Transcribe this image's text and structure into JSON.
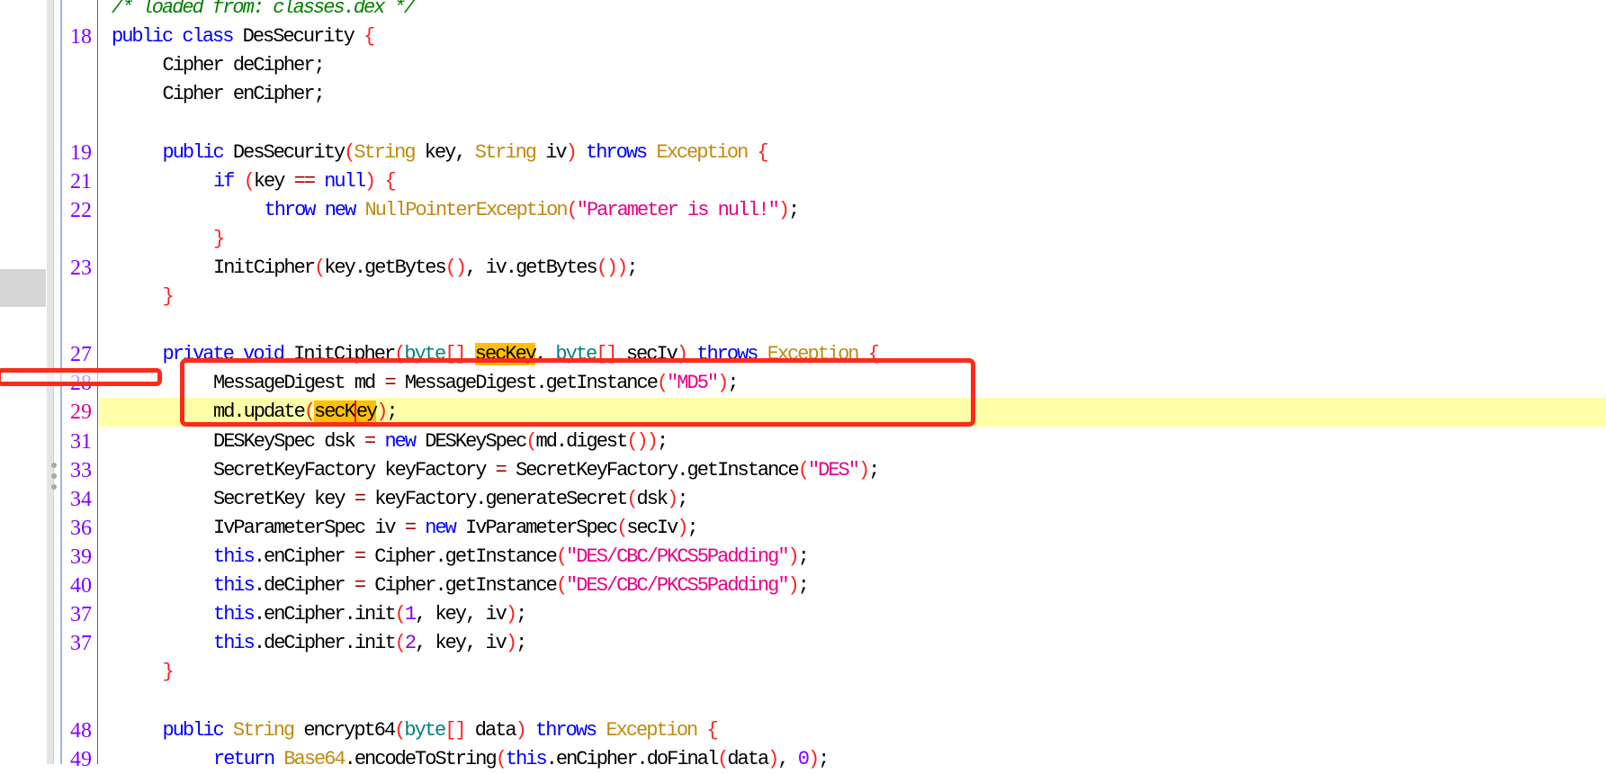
{
  "editor": {
    "colors": {
      "keyword": "#0000ff",
      "type": "#c08a10",
      "paren": "#ff2020",
      "string": "#e6008a",
      "comment": "#008000",
      "line_number": "#8000ff",
      "current_line": "#ffffa8",
      "highlight": "#ffc000",
      "annotation": "#ff2a1a"
    },
    "current_line_number": "29",
    "lines": [
      {
        "n": "",
        "i": 0,
        "t": [
          [
            "/* loaded from: classes.dex */",
            "c"
          ]
        ]
      },
      {
        "n": "18",
        "i": 0,
        "t": [
          [
            "public class",
            "k"
          ],
          [
            " DesSecurity ",
            "v"
          ],
          [
            "{",
            "p"
          ]
        ]
      },
      {
        "n": "",
        "i": 1,
        "t": [
          [
            "Cipher deCipher;",
            "v"
          ]
        ]
      },
      {
        "n": "",
        "i": 1,
        "t": [
          [
            "Cipher enCipher;",
            "v"
          ]
        ]
      },
      {
        "n": "",
        "i": 0,
        "t": []
      },
      {
        "n": "19",
        "i": 1,
        "t": [
          [
            "public",
            "k"
          ],
          [
            " DesSecurity",
            "v"
          ],
          [
            "(",
            "p"
          ],
          [
            "String",
            "ty"
          ],
          [
            " key, ",
            "v"
          ],
          [
            "String",
            "ty"
          ],
          [
            " iv",
            "v"
          ],
          [
            ")",
            "p"
          ],
          [
            " throws ",
            "k"
          ],
          [
            "Exception ",
            "ty"
          ],
          [
            "{",
            "p"
          ]
        ]
      },
      {
        "n": "21",
        "i": 2,
        "t": [
          [
            "if ",
            "k"
          ],
          [
            "(",
            "p"
          ],
          [
            "key ",
            "v"
          ],
          [
            "==",
            "op"
          ],
          [
            " null",
            "k"
          ],
          [
            ")",
            "p"
          ],
          [
            " {",
            "p"
          ]
        ]
      },
      {
        "n": "22",
        "i": 3,
        "t": [
          [
            "throw new ",
            "k"
          ],
          [
            "NullPointerException",
            "ty"
          ],
          [
            "(",
            "p"
          ],
          [
            "\"Parameter is null!\"",
            "s"
          ],
          [
            ")",
            "p"
          ],
          [
            ";",
            "v"
          ]
        ]
      },
      {
        "n": "",
        "i": 2,
        "t": [
          [
            "}",
            "p"
          ]
        ]
      },
      {
        "n": "23",
        "i": 2,
        "t": [
          [
            "InitCipher",
            "v"
          ],
          [
            "(",
            "p"
          ],
          [
            "key.getBytes",
            "v"
          ],
          [
            "()",
            "p"
          ],
          [
            ", iv.getBytes",
            "v"
          ],
          [
            "())",
            "p"
          ],
          [
            ";",
            "v"
          ]
        ]
      },
      {
        "n": "",
        "i": 1,
        "t": [
          [
            "}",
            "p"
          ]
        ]
      },
      {
        "n": "",
        "i": 0,
        "t": []
      },
      {
        "n": "27",
        "i": 1,
        "t": [
          [
            "private void",
            "k"
          ],
          [
            " InitCipher",
            "v"
          ],
          [
            "(",
            "p"
          ],
          [
            "byte",
            "te"
          ],
          [
            "[]",
            "p"
          ],
          [
            " ",
            "v"
          ],
          [
            "secKey",
            "v hl"
          ],
          [
            ", ",
            "v"
          ],
          [
            "byte",
            "te"
          ],
          [
            "[]",
            "p"
          ],
          [
            " secIv",
            "v"
          ],
          [
            ")",
            "p"
          ],
          [
            " throws ",
            "k"
          ],
          [
            "Exception ",
            "ty"
          ],
          [
            "{",
            "p"
          ]
        ]
      },
      {
        "n": "28",
        "i": 2,
        "t": [
          [
            "MessageDigest md ",
            "v"
          ],
          [
            "=",
            "op"
          ],
          [
            " MessageDigest.getInstance",
            "v"
          ],
          [
            "(",
            "p"
          ],
          [
            "\"MD5\"",
            "s"
          ],
          [
            ")",
            "p"
          ],
          [
            ";",
            "v"
          ]
        ]
      },
      {
        "n": "29",
        "i": 2,
        "t": [
          [
            "md.update",
            "v"
          ],
          [
            "(",
            "p"
          ],
          [
            "secK",
            "v hl"
          ],
          [
            "ey",
            "v hl cur"
          ],
          [
            ")",
            "p"
          ],
          [
            ";",
            "v"
          ]
        ]
      },
      {
        "n": "31",
        "i": 2,
        "t": [
          [
            "DESKeySpec dsk ",
            "v"
          ],
          [
            "=",
            "op"
          ],
          [
            " new ",
            "k"
          ],
          [
            "DESKeySpec",
            "v"
          ],
          [
            "(",
            "p"
          ],
          [
            "md.digest",
            "v"
          ],
          [
            "())",
            "p"
          ],
          [
            ";",
            "v"
          ]
        ]
      },
      {
        "n": "33",
        "i": 2,
        "t": [
          [
            "SecretKeyFactory keyFactory ",
            "v"
          ],
          [
            "=",
            "op"
          ],
          [
            " SecretKeyFactory.getInstance",
            "v"
          ],
          [
            "(",
            "p"
          ],
          [
            "\"DES\"",
            "s"
          ],
          [
            ")",
            "p"
          ],
          [
            ";",
            "v"
          ]
        ]
      },
      {
        "n": "34",
        "i": 2,
        "t": [
          [
            "SecretKey key ",
            "v"
          ],
          [
            "=",
            "op"
          ],
          [
            " keyFactory.generateSecret",
            "v"
          ],
          [
            "(",
            "p"
          ],
          [
            "dsk",
            "v"
          ],
          [
            ")",
            "p"
          ],
          [
            ";",
            "v"
          ]
        ]
      },
      {
        "n": "36",
        "i": 2,
        "t": [
          [
            "IvParameterSpec iv ",
            "v"
          ],
          [
            "=",
            "op"
          ],
          [
            " new ",
            "k"
          ],
          [
            "IvParameterSpec",
            "v"
          ],
          [
            "(",
            "p"
          ],
          [
            "secIv",
            "v"
          ],
          [
            ")",
            "p"
          ],
          [
            ";",
            "v"
          ]
        ]
      },
      {
        "n": "39",
        "i": 2,
        "t": [
          [
            "this",
            "k"
          ],
          [
            ".enCipher ",
            "v"
          ],
          [
            "=",
            "op"
          ],
          [
            " Cipher.getInstance",
            "v"
          ],
          [
            "(",
            "p"
          ],
          [
            "\"DES/CBC/PKCS5Padding\"",
            "s"
          ],
          [
            ")",
            "p"
          ],
          [
            ";",
            "v"
          ]
        ]
      },
      {
        "n": "40",
        "i": 2,
        "t": [
          [
            "this",
            "k"
          ],
          [
            ".deCipher ",
            "v"
          ],
          [
            "=",
            "op"
          ],
          [
            " Cipher.getInstance",
            "v"
          ],
          [
            "(",
            "p"
          ],
          [
            "\"DES/CBC/PKCS5Padding\"",
            "s"
          ],
          [
            ")",
            "p"
          ],
          [
            ";",
            "v"
          ]
        ]
      },
      {
        "n": "37",
        "i": 2,
        "t": [
          [
            "this",
            "k"
          ],
          [
            ".enCipher.init",
            "v"
          ],
          [
            "(",
            "p"
          ],
          [
            "1",
            "nm"
          ],
          [
            ", key, iv",
            "v"
          ],
          [
            ")",
            "p"
          ],
          [
            ";",
            "v"
          ]
        ]
      },
      {
        "n": "37",
        "i": 2,
        "t": [
          [
            "this",
            "k"
          ],
          [
            ".deCipher.init",
            "v"
          ],
          [
            "(",
            "p"
          ],
          [
            "2",
            "nm"
          ],
          [
            ", key, iv",
            "v"
          ],
          [
            ")",
            "p"
          ],
          [
            ";",
            "v"
          ]
        ]
      },
      {
        "n": "",
        "i": 1,
        "t": [
          [
            "}",
            "p"
          ]
        ]
      },
      {
        "n": "",
        "i": 0,
        "t": []
      },
      {
        "n": "48",
        "i": 1,
        "t": [
          [
            "public ",
            "k"
          ],
          [
            "String",
            "ty"
          ],
          [
            " encrypt64",
            "v"
          ],
          [
            "(",
            "p"
          ],
          [
            "byte",
            "te"
          ],
          [
            "[]",
            "p"
          ],
          [
            " data",
            "v"
          ],
          [
            ")",
            "p"
          ],
          [
            " throws ",
            "k"
          ],
          [
            "Exception ",
            "ty"
          ],
          [
            "{",
            "p"
          ]
        ]
      },
      {
        "n": "49",
        "i": 2,
        "t": [
          [
            "return ",
            "k"
          ],
          [
            "Base64",
            "ty"
          ],
          [
            ".encodeToString",
            "v"
          ],
          [
            "(",
            "p"
          ],
          [
            "this",
            "k"
          ],
          [
            ".enCipher.doFinal",
            "v"
          ],
          [
            "(",
            "p"
          ],
          [
            "data",
            "v"
          ],
          [
            ")",
            "p"
          ],
          [
            ", ",
            "v"
          ],
          [
            "0",
            "nm"
          ],
          [
            ")",
            "p"
          ],
          [
            ";",
            "v"
          ]
        ]
      }
    ]
  }
}
